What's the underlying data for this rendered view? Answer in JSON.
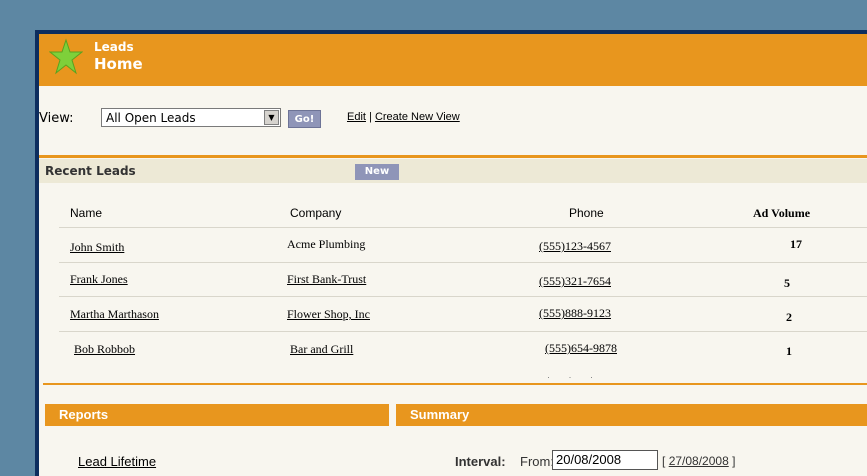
{
  "header": {
    "title": "Leads",
    "subtitle": "Home",
    "icon": "star-icon",
    "color": "#e8961e"
  },
  "view": {
    "label": "View:",
    "selected": "All Open Leads",
    "go_label": "Go!",
    "edit_label": "Edit",
    "separator": "|",
    "create_label": "Create New View"
  },
  "recent": {
    "title": "Recent Leads",
    "new_label": "New",
    "columns": [
      "Name",
      "Company",
      "Phone",
      "Ad Volume"
    ],
    "rows": [
      {
        "name": "John Smith",
        "company": "Acme Plumbing",
        "phone": "(555)123-4567",
        "ad_volume": "17"
      },
      {
        "name": "Frank Jones",
        "company": "First Bank-Trust",
        "phone": "(555)321-7654",
        "ad_volume": "5"
      },
      {
        "name": "Martha Marthason",
        "company": "Flower Shop, Inc",
        "phone": "(555)888-9123",
        "ad_volume": "2"
      },
      {
        "name": "Bob Robbob",
        "company": "Bar and Grill",
        "phone": "(555)654-9878",
        "ad_volume": "1"
      }
    ]
  },
  "reports": {
    "title": "Reports",
    "items": [
      "Lead Lifetime"
    ]
  },
  "summary": {
    "title": "Summary",
    "interval_label": "Interval:",
    "from_label": "From:",
    "from_value": "20/08/2008",
    "to_open": "[",
    "to_value": "27/08/2008",
    "to_close": "]"
  }
}
